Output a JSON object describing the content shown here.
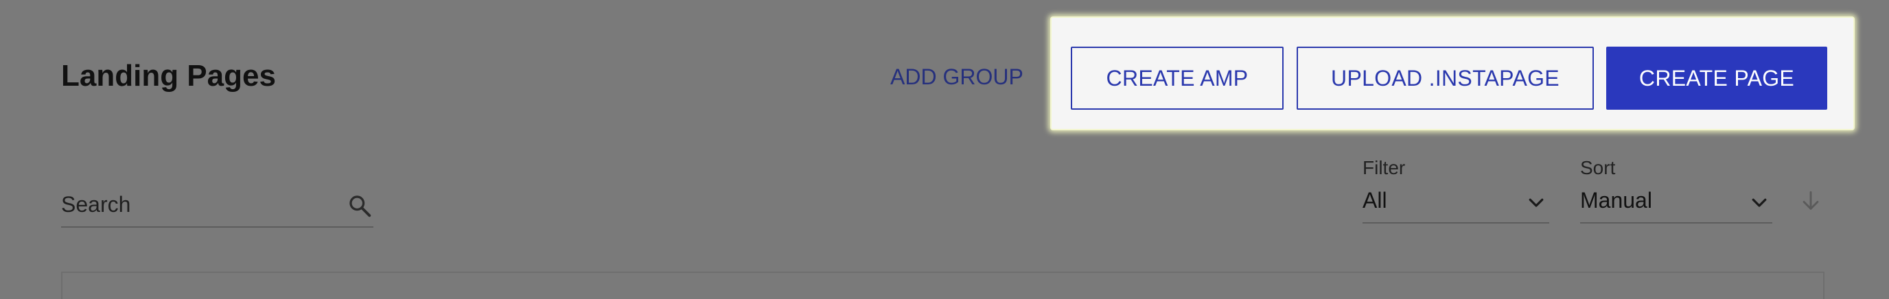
{
  "header": {
    "title": "Landing Pages",
    "add_group_label": "ADD GROUP"
  },
  "actions": {
    "create_amp_label": "CREATE AMP",
    "upload_label": "UPLOAD .INSTAPAGE",
    "create_page_label": "CREATE PAGE"
  },
  "search": {
    "placeholder": "Search",
    "value": "",
    "icon": "search-icon"
  },
  "filter": {
    "label": "Filter",
    "selected": "All",
    "icon": "chevron-down-icon"
  },
  "sort": {
    "label": "Sort",
    "selected": "Manual",
    "direction_icon": "arrow-down-icon"
  },
  "colors": {
    "overlay_background": "#7a7a7a",
    "highlight_background": "#f5f5f5",
    "highlight_glow": "#f3f6cf",
    "primary": "#2a38bd",
    "link": "#26307d"
  }
}
